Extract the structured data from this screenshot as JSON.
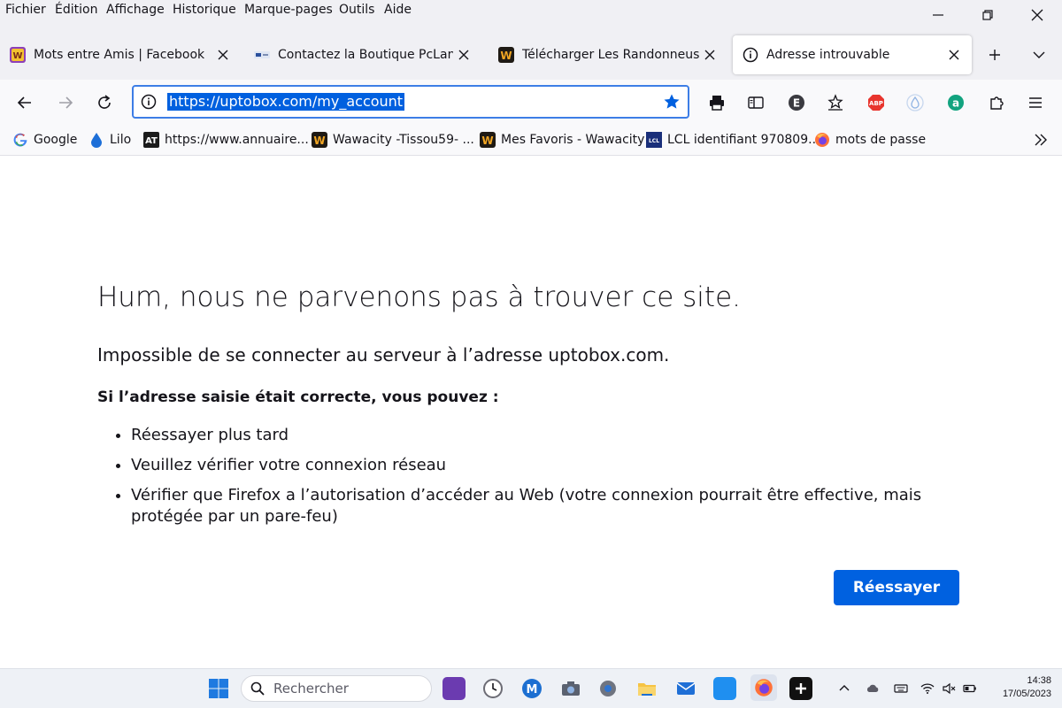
{
  "menubar": {
    "items": [
      "Fichier",
      "Édition",
      "Affichage",
      "Historique",
      "Marque-pages",
      "Outils",
      "Aide"
    ]
  },
  "tabs": [
    {
      "title": "Mots entre Amis | Facebook",
      "favicon": "wordsfriends-icon"
    },
    {
      "title": "Contactez la Boutique PcLanD ra",
      "favicon": "pcland-icon"
    },
    {
      "title": "Télécharger Les Randonneuses -",
      "favicon": "wawacity-icon"
    },
    {
      "title": "Adresse introuvable",
      "favicon": "info-icon",
      "active": true
    }
  ],
  "navbar": {
    "url": "https://uptobox.com/my_account"
  },
  "bookmarks": [
    {
      "label": "Google",
      "icon": "google-icon"
    },
    {
      "label": "Lilo",
      "icon": "lilo-drop-icon"
    },
    {
      "label": "https://www.annuaire...",
      "icon": "annuaire-icon"
    },
    {
      "label": "Wawacity -Tissou59-  ...",
      "icon": "wawacity-icon"
    },
    {
      "label": "Mes Favoris - Wawacity",
      "icon": "wawacity-icon"
    },
    {
      "label": "LCL identifiant 970809...",
      "icon": "lcl-icon"
    },
    {
      "label": "mots de passe",
      "icon": "firefox-icon"
    }
  ],
  "error_page": {
    "title": "Hum, nous ne parvenons pas à trouver ce site.",
    "subtitle": "Impossible de se connecter au serveur à l’adresse uptobox.com.",
    "lead": "Si l’adresse saisie était correcte, vous pouvez :",
    "suggestions": [
      "Réessayer plus tard",
      "Veuillez vérifier votre connexion réseau",
      "Vérifier que Firefox a l’autorisation d’accéder au Web (votre connexion pourrait être effective, mais protégée par un pare-feu)"
    ],
    "retry_label": "Réessayer"
  },
  "taskbar": {
    "search_placeholder": "Rechercher",
    "time": "14:38",
    "date": "17/05/2023"
  },
  "colors": {
    "accent": "#0061e0",
    "url_highlight": "#0060df",
    "tabstrip_bg": "#f0f0f4"
  }
}
